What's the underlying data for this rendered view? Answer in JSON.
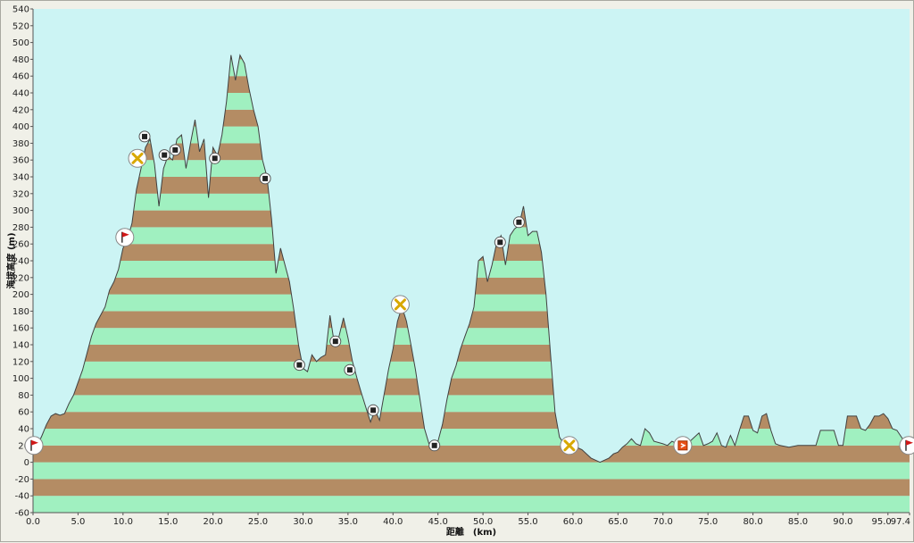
{
  "chart_data": {
    "type": "area",
    "title": "",
    "ylabel": "海拔高度 (m)",
    "xlabel": "距離　(km)",
    "xlim": [
      0,
      97.4
    ],
    "ylim": [
      -60,
      540
    ],
    "y_ticks": [
      -60,
      -40,
      -20,
      0,
      20,
      40,
      60,
      80,
      100,
      120,
      140,
      160,
      180,
      200,
      220,
      240,
      260,
      280,
      300,
      320,
      340,
      360,
      380,
      400,
      420,
      440,
      460,
      480,
      500,
      520,
      540
    ],
    "x_ticks": [
      "0.0",
      "5.0",
      "10.0",
      "15.0",
      "20.0",
      "25.0",
      "30.0",
      "35.0",
      "40.0",
      "45.0",
      "50.0",
      "55.0",
      "60.0",
      "65.0",
      "70.0",
      "75.0",
      "80.0",
      "85.0",
      "90.0",
      "95.0",
      "97.4"
    ],
    "grid": false,
    "band_colors": [
      "#a0f0c0",
      "#b48c64"
    ],
    "plot_background": "#ccf4f4",
    "outline_color": "#404040",
    "profile": [
      [
        0,
        18
      ],
      [
        0.5,
        20
      ],
      [
        1.0,
        32
      ],
      [
        1.5,
        45
      ],
      [
        2.0,
        55
      ],
      [
        2.5,
        58
      ],
      [
        3.0,
        56
      ],
      [
        3.5,
        58
      ],
      [
        4.0,
        70
      ],
      [
        4.5,
        80
      ],
      [
        5.0,
        95
      ],
      [
        5.5,
        110
      ],
      [
        6.0,
        130
      ],
      [
        6.5,
        150
      ],
      [
        7.0,
        165
      ],
      [
        7.5,
        175
      ],
      [
        8.0,
        185
      ],
      [
        8.5,
        205
      ],
      [
        9.0,
        215
      ],
      [
        9.5,
        230
      ],
      [
        10.0,
        255
      ],
      [
        10.5,
        265
      ],
      [
        11.0,
        285
      ],
      [
        11.5,
        325
      ],
      [
        12.0,
        350
      ],
      [
        12.5,
        375
      ],
      [
        13.0,
        385
      ],
      [
        13.5,
        355
      ],
      [
        14.0,
        305
      ],
      [
        14.5,
        350
      ],
      [
        15.0,
        365
      ],
      [
        15.5,
        360
      ],
      [
        16.0,
        385
      ],
      [
        16.5,
        390
      ],
      [
        17.0,
        350
      ],
      [
        17.5,
        380
      ],
      [
        18.0,
        408
      ],
      [
        18.5,
        370
      ],
      [
        19.0,
        385
      ],
      [
        19.5,
        315
      ],
      [
        20.0,
        375
      ],
      [
        20.5,
        365
      ],
      [
        21.0,
        390
      ],
      [
        21.5,
        430
      ],
      [
        22.0,
        485
      ],
      [
        22.5,
        455
      ],
      [
        23.0,
        485
      ],
      [
        23.5,
        475
      ],
      [
        24.0,
        445
      ],
      [
        24.5,
        420
      ],
      [
        25.0,
        400
      ],
      [
        25.5,
        360
      ],
      [
        26.0,
        340
      ],
      [
        26.5,
        290
      ],
      [
        27.0,
        225
      ],
      [
        27.5,
        255
      ],
      [
        28.0,
        235
      ],
      [
        28.5,
        215
      ],
      [
        29.0,
        180
      ],
      [
        29.5,
        140
      ],
      [
        30.0,
        112
      ],
      [
        30.5,
        108
      ],
      [
        31.0,
        128
      ],
      [
        31.5,
        120
      ],
      [
        32.0,
        125
      ],
      [
        32.5,
        128
      ],
      [
        33.0,
        175
      ],
      [
        33.5,
        140
      ],
      [
        34.0,
        150
      ],
      [
        34.5,
        172
      ],
      [
        35.0,
        148
      ],
      [
        35.5,
        120
      ],
      [
        36.0,
        100
      ],
      [
        36.5,
        82
      ],
      [
        37.0,
        65
      ],
      [
        37.5,
        48
      ],
      [
        38.0,
        62
      ],
      [
        38.5,
        50
      ],
      [
        39.0,
        80
      ],
      [
        39.5,
        110
      ],
      [
        40.0,
        135
      ],
      [
        40.5,
        168
      ],
      [
        41.0,
        185
      ],
      [
        41.5,
        168
      ],
      [
        42.0,
        140
      ],
      [
        42.5,
        110
      ],
      [
        43.0,
        75
      ],
      [
        43.5,
        40
      ],
      [
        44.0,
        22
      ],
      [
        44.5,
        20
      ],
      [
        45.0,
        25
      ],
      [
        45.5,
        45
      ],
      [
        46.0,
        75
      ],
      [
        46.5,
        100
      ],
      [
        47.0,
        115
      ],
      [
        47.5,
        135
      ],
      [
        48.0,
        150
      ],
      [
        48.5,
        165
      ],
      [
        49.0,
        185
      ],
      [
        49.5,
        240
      ],
      [
        50.0,
        245
      ],
      [
        50.5,
        215
      ],
      [
        51.0,
        235
      ],
      [
        51.5,
        260
      ],
      [
        52.0,
        270
      ],
      [
        52.5,
        235
      ],
      [
        53.0,
        270
      ],
      [
        53.5,
        278
      ],
      [
        54.0,
        282
      ],
      [
        54.5,
        305
      ],
      [
        55.0,
        270
      ],
      [
        55.5,
        275
      ],
      [
        56.0,
        275
      ],
      [
        56.5,
        250
      ],
      [
        57.0,
        200
      ],
      [
        57.5,
        130
      ],
      [
        58.0,
        60
      ],
      [
        58.5,
        30
      ],
      [
        59.0,
        22
      ],
      [
        60.0,
        20
      ],
      [
        61.0,
        15
      ],
      [
        62.0,
        5
      ],
      [
        63.0,
        0
      ],
      [
        64.0,
        5
      ],
      [
        64.5,
        10
      ],
      [
        65.0,
        12
      ],
      [
        65.5,
        18
      ],
      [
        66.0,
        22
      ],
      [
        66.5,
        28
      ],
      [
        67.0,
        22
      ],
      [
        67.5,
        20
      ],
      [
        68.0,
        40
      ],
      [
        68.5,
        35
      ],
      [
        69.0,
        25
      ],
      [
        70.0,
        22
      ],
      [
        70.5,
        20
      ],
      [
        71.0,
        25
      ],
      [
        72.0,
        20
      ],
      [
        73.0,
        25
      ],
      [
        74.0,
        35
      ],
      [
        74.5,
        20
      ],
      [
        75.0,
        22
      ],
      [
        75.5,
        25
      ],
      [
        76.0,
        35
      ],
      [
        76.5,
        20
      ],
      [
        77.0,
        18
      ],
      [
        77.5,
        32
      ],
      [
        78.0,
        20
      ],
      [
        78.5,
        38
      ],
      [
        79.0,
        55
      ],
      [
        79.5,
        55
      ],
      [
        80.0,
        38
      ],
      [
        80.5,
        35
      ],
      [
        81.0,
        55
      ],
      [
        81.5,
        58
      ],
      [
        82.0,
        38
      ],
      [
        82.5,
        22
      ],
      [
        83.0,
        20
      ],
      [
        84.0,
        18
      ],
      [
        85.0,
        20
      ],
      [
        86.0,
        20
      ],
      [
        87.0,
        20
      ],
      [
        87.5,
        38
      ],
      [
        88.0,
        38
      ],
      [
        89.0,
        38
      ],
      [
        89.5,
        20
      ],
      [
        90.0,
        20
      ],
      [
        90.5,
        55
      ],
      [
        91.5,
        55
      ],
      [
        92.0,
        40
      ],
      [
        92.5,
        38
      ],
      [
        93.0,
        45
      ],
      [
        93.5,
        55
      ],
      [
        94.0,
        55
      ],
      [
        94.5,
        58
      ],
      [
        95.0,
        52
      ],
      [
        95.5,
        40
      ],
      [
        96.0,
        38
      ],
      [
        96.5,
        30
      ],
      [
        97.0,
        22
      ],
      [
        97.4,
        20
      ]
    ],
    "markers": [
      {
        "type": "flag",
        "x": 0.0,
        "y": 20
      },
      {
        "type": "flag",
        "x": 10.2,
        "y": 268
      },
      {
        "type": "cross",
        "x": 11.6,
        "y": 362
      },
      {
        "type": "square",
        "x": 12.4,
        "y": 388
      },
      {
        "type": "square",
        "x": 14.6,
        "y": 366
      },
      {
        "type": "square",
        "x": 15.8,
        "y": 372
      },
      {
        "type": "square",
        "x": 20.2,
        "y": 362
      },
      {
        "type": "square",
        "x": 25.8,
        "y": 338
      },
      {
        "type": "square",
        "x": 29.6,
        "y": 116
      },
      {
        "type": "square",
        "x": 33.6,
        "y": 144
      },
      {
        "type": "square",
        "x": 35.2,
        "y": 110
      },
      {
        "type": "square",
        "x": 37.8,
        "y": 62
      },
      {
        "type": "cross",
        "x": 40.8,
        "y": 188
      },
      {
        "type": "square",
        "x": 44.6,
        "y": 20
      },
      {
        "type": "square",
        "x": 51.9,
        "y": 262
      },
      {
        "type": "square",
        "x": 54.0,
        "y": 286
      },
      {
        "type": "cross",
        "x": 59.6,
        "y": 20
      },
      {
        "type": "sign",
        "x": 72.2,
        "y": 20
      },
      {
        "type": "flag",
        "x": 97.4,
        "y": 20
      }
    ]
  }
}
